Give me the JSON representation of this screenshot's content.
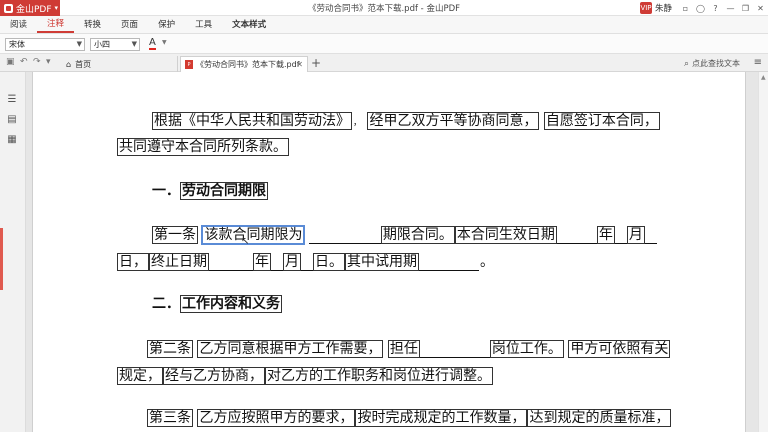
{
  "titlebar": {
    "app_name": "金山PDF",
    "window_title": "《劳动合同书》范本下载.pdf - 金山PDF",
    "user_badge": "VIP",
    "user_name": "朱静",
    "buttons": [
      "▫",
      "◯",
      "?",
      "—",
      "❐",
      "✕"
    ]
  },
  "menu": {
    "items": [
      {
        "label": "阅读"
      },
      {
        "label": "注释"
      },
      {
        "label": "转换"
      },
      {
        "label": "页面"
      },
      {
        "label": "保护"
      },
      {
        "label": "工具"
      },
      {
        "label": "文本样式"
      }
    ],
    "active": "注释"
  },
  "format": {
    "font": "宋体",
    "size": "小四",
    "font_color_glyph": "A"
  },
  "tabs": {
    "home_label": "首页",
    "doc_label": "《劳动合同书》范本下载.pdf",
    "search_other": "点此查找文本"
  },
  "document": {
    "p1_line1": {
      "s1": "根据《中华人民共和国劳动法》",
      "s2": "，",
      "s3": "经甲乙双方平等协商同意，",
      "s4": "自愿签订本合同，"
    },
    "p1_line2": "共同遵守本合同所列条款。",
    "h1": "一．",
    "h1_text": "劳动合同期限",
    "art1_line1": {
      "s1": "第一条",
      "s2": "该款合同期限为",
      "s3": "期限合同。",
      "s4": "本合同生效日期",
      "s5": "年",
      "s6": "月"
    },
    "art1_line2": {
      "s1": "日，",
      "s2": "终止日期",
      "s3": "年",
      "s4": "月",
      "s5": "日。",
      "s6": "其中试用期",
      "s7": "。"
    },
    "h2": "二．",
    "h2_text": "工作内容和义务",
    "art2_line1": {
      "s1": "第二条",
      "s2": "乙方同意根据甲方工作需要，",
      "s3": "担任",
      "s4": "岗位工作。",
      "s5": "甲方可依照有关"
    },
    "art2_line2": {
      "s1": "规定，",
      "s2": "经与乙方协商，",
      "s3": "对乙方的工作职务和岗位进行调整。"
    },
    "art3_line1": {
      "s1": "第三条",
      "s2": "乙方应按照甲方的要求，",
      "s3": "按时完成规定的工作数量，",
      "s4": "达到规定的质量标准，"
    }
  },
  "colors": {
    "brand": "#cf3b35",
    "selection": "#5a8bd6"
  }
}
